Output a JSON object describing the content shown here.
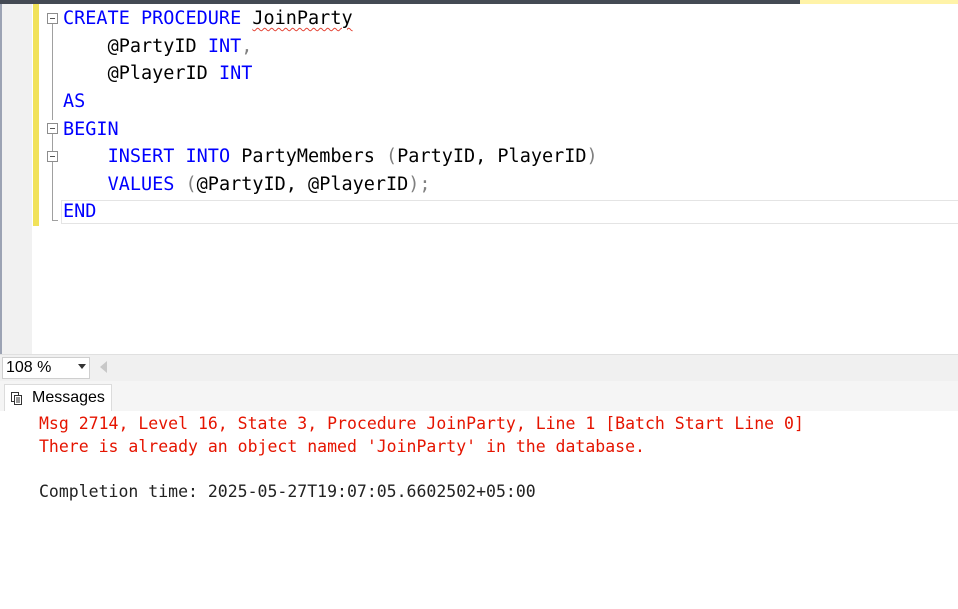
{
  "editor": {
    "lines": [
      {
        "kw1": "CREATE PROCEDURE",
        "name": "JoinParty"
      },
      {
        "var": "@PartyID",
        "type": "INT",
        "punct": ","
      },
      {
        "var": "@PlayerID",
        "type": "INT"
      },
      {
        "kw": "AS"
      },
      {
        "kw": "BEGIN"
      },
      {
        "kw": "INSERT INTO",
        "table": "PartyMembers",
        "open": "(",
        "cols": "PartyID, PlayerID",
        "close": ")"
      },
      {
        "kw": "VALUES",
        "open": "(",
        "vals": "@PartyID, @PlayerID",
        "close": ");"
      },
      {
        "kw": "END"
      }
    ]
  },
  "zoom": {
    "level": "108 %"
  },
  "results": {
    "tab_label": "Messages",
    "error_line_1": "Msg 2714, Level 16, State 3, Procedure JoinParty, Line 1 [Batch Start Line 0]",
    "error_line_2": "There is already an object named 'JoinParty' in the database.",
    "completion": "Completion time: 2025-05-27T19:07:05.6602502+05:00"
  },
  "colors": {
    "keyword": "#0000ff",
    "error": "#e51400",
    "change_bar": "#f1e25a"
  }
}
